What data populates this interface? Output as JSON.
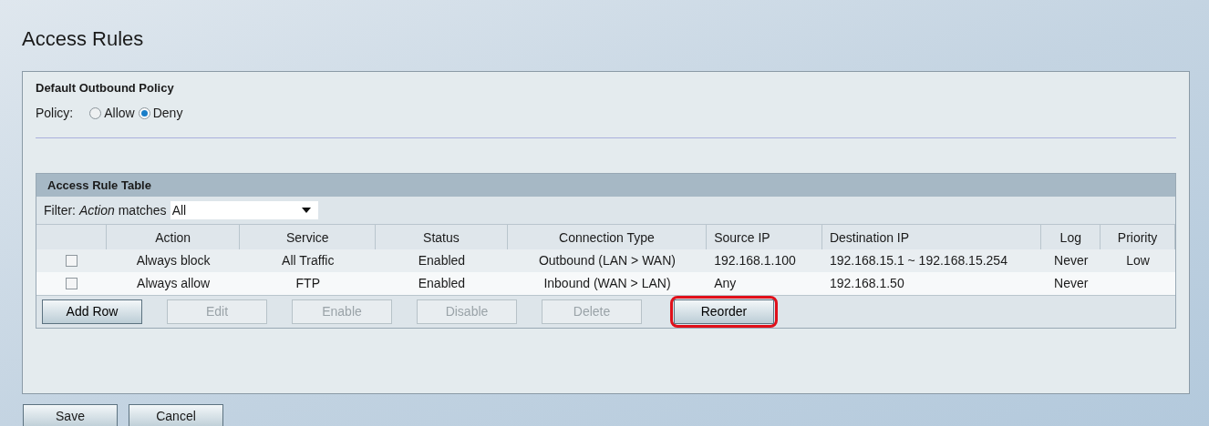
{
  "title": "Access Rules",
  "policy_section": {
    "heading": "Default Outbound Policy",
    "label": "Policy:",
    "options": [
      {
        "label": "Allow",
        "selected": false
      },
      {
        "label": "Deny",
        "selected": true
      }
    ]
  },
  "table": {
    "heading": "Access Rule Table",
    "filter": {
      "prefix": "Filter:",
      "field": "Action",
      "suffix": "matches",
      "value": "All"
    },
    "columns": [
      "Action",
      "Service",
      "Status",
      "Connection Type",
      "Source IP",
      "Destination IP",
      "Log",
      "Priority"
    ],
    "rows": [
      {
        "checked": false,
        "cells": [
          "Always block",
          "All Traffic",
          "Enabled",
          "Outbound (LAN > WAN)",
          "192.168.1.100",
          "192.168.15.1 ~ 192.168.15.254",
          "Never",
          "Low"
        ]
      },
      {
        "checked": false,
        "cells": [
          "Always allow",
          "FTP",
          "Enabled",
          "Inbound (WAN > LAN)",
          "Any",
          "192.168.1.50",
          "Never",
          ""
        ]
      }
    ],
    "buttons": [
      {
        "label": "Add Row",
        "disabled": false,
        "highlighted": false
      },
      {
        "label": "Edit",
        "disabled": true,
        "highlighted": false
      },
      {
        "label": "Enable",
        "disabled": true,
        "highlighted": false
      },
      {
        "label": "Disable",
        "disabled": true,
        "highlighted": false
      },
      {
        "label": "Delete",
        "disabled": true,
        "highlighted": false
      },
      {
        "label": "Reorder",
        "disabled": false,
        "highlighted": true
      }
    ]
  },
  "buttons": [
    {
      "label": "Save"
    },
    {
      "label": "Cancel"
    }
  ]
}
